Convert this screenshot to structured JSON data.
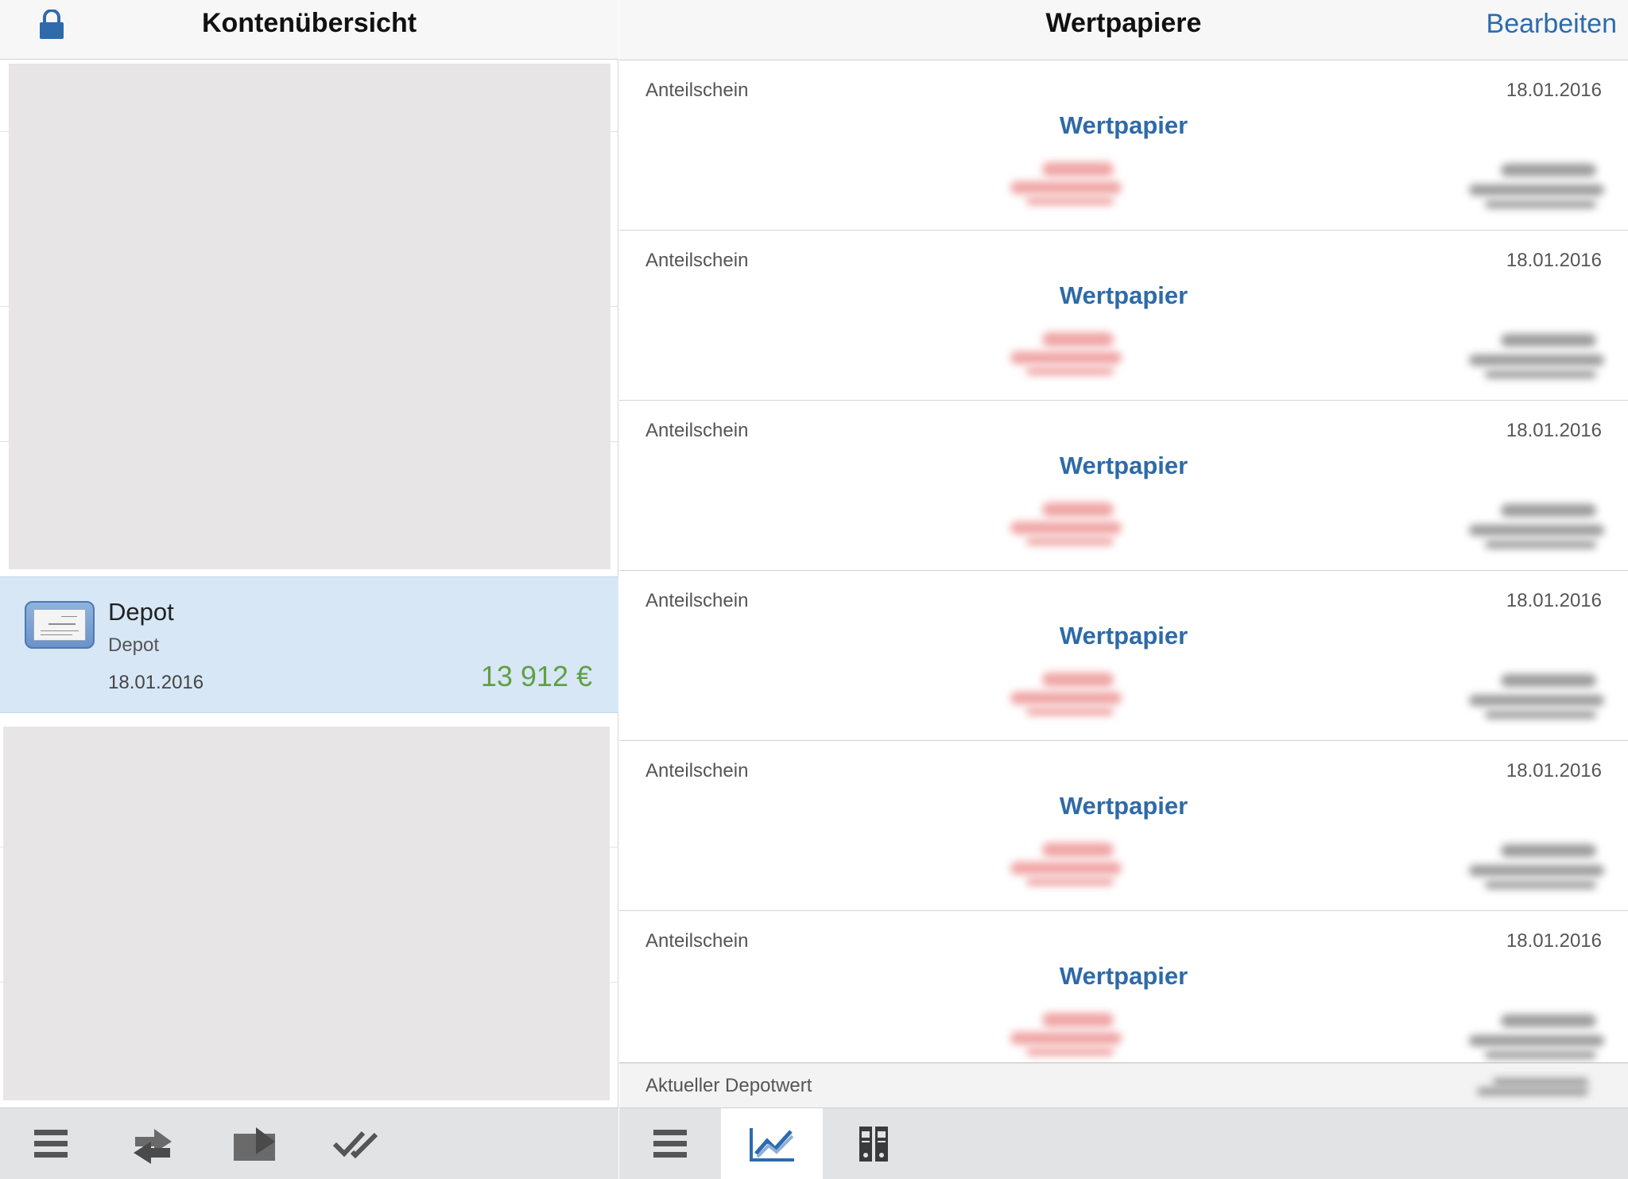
{
  "left_pane": {
    "title": "Kontenübersicht",
    "lock_icon": "lock-icon",
    "selected_account": {
      "name": "Depot",
      "type": "Depot",
      "date": "18.01.2016",
      "balance": "13 912 €",
      "balance_color": "#5fa044"
    },
    "toolbar": [
      {
        "icon": "list-icon"
      },
      {
        "icon": "transfer-icon"
      },
      {
        "icon": "send-icon"
      },
      {
        "icon": "double-check-icon"
      }
    ]
  },
  "right_pane": {
    "title": "Wertpapiere",
    "edit_label": "Bearbeiten",
    "securities": [
      {
        "type": "Anteilschein",
        "date": "18.01.2016",
        "name": "Wertpapier"
      },
      {
        "type": "Anteilschein",
        "date": "18.01.2016",
        "name": "Wertpapier"
      },
      {
        "type": "Anteilschein",
        "date": "18.01.2016",
        "name": "Wertpapier"
      },
      {
        "type": "Anteilschein",
        "date": "18.01.2016",
        "name": "Wertpapier"
      },
      {
        "type": "Anteilschein",
        "date": "18.01.2016",
        "name": "Wertpapier"
      },
      {
        "type": "Anteilschein",
        "date": "18.01.2016",
        "name": "Wertpapier"
      }
    ],
    "footer_label": "Aktueller Depotwert",
    "toolbar": [
      {
        "icon": "list-icon",
        "active": false
      },
      {
        "icon": "chart-icon",
        "active": true
      },
      {
        "icon": "binders-icon",
        "active": false
      }
    ]
  },
  "colors": {
    "accent": "#2c6bb0",
    "selection": "#d7e7f6",
    "security_name": "#2e6aa8"
  }
}
